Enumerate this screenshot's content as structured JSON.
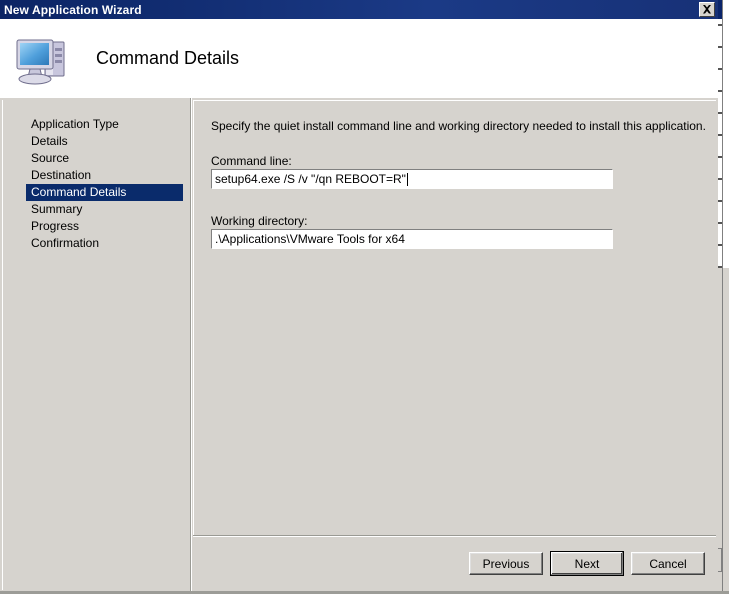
{
  "window": {
    "title": "New Application Wizard",
    "close_label": "Close",
    "close_icon": "close-x-icon"
  },
  "header": {
    "title": "Command Details",
    "icon": "computer-icon"
  },
  "sidebar": {
    "items": [
      {
        "label": "Application Type",
        "active": false
      },
      {
        "label": "Details",
        "active": false
      },
      {
        "label": "Source",
        "active": false
      },
      {
        "label": "Destination",
        "active": false
      },
      {
        "label": "Command Details",
        "active": true
      },
      {
        "label": "Summary",
        "active": false
      },
      {
        "label": "Progress",
        "active": false
      },
      {
        "label": "Confirmation",
        "active": false
      }
    ]
  },
  "content": {
    "instruction": "Specify the quiet install command line and working directory needed to install this application.",
    "fields": [
      {
        "label": "Command line:",
        "value": "setup64.exe /S /v \"/qn REBOOT=R\"",
        "placeholder": "",
        "focused": true
      },
      {
        "label": "Working directory:",
        "value": ".\\Applications\\VMware Tools for x64",
        "placeholder": "",
        "focused": false
      }
    ]
  },
  "buttons": {
    "previous": "Previous",
    "next": "Next",
    "cancel": "Cancel"
  },
  "colors": {
    "titlebar": "#0b2464",
    "dialog_face": "#d6d3ce",
    "selection": "#0a2b6b",
    "header_bg": "#ffffff",
    "text": "#000000"
  }
}
